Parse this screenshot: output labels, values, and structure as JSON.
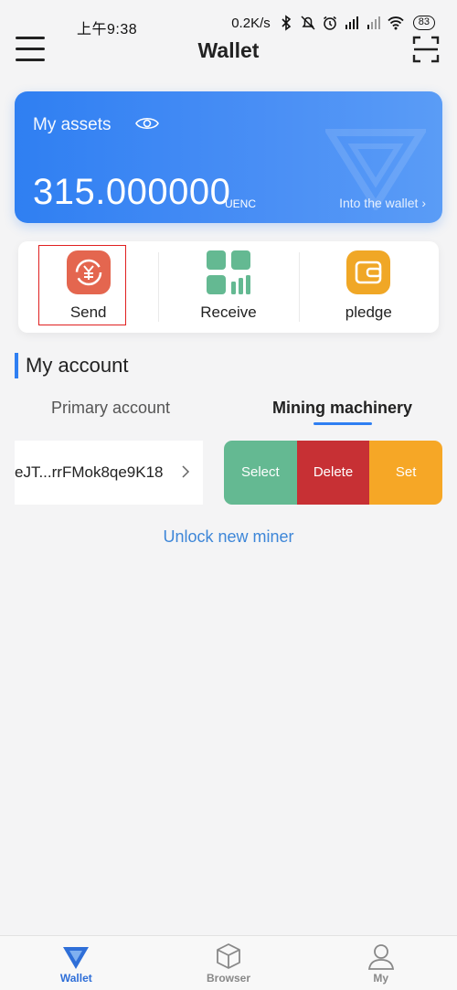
{
  "status_bar": {
    "time": "上午9:38",
    "speed": "0.2K/s",
    "battery": "83"
  },
  "header": {
    "title": "Wallet"
  },
  "assets": {
    "label": "My assets",
    "amount": "315.000000",
    "unit": "UENC",
    "into_wallet": "Into the wallet ›"
  },
  "actions": [
    {
      "label": "Send",
      "icon": "send-icon"
    },
    {
      "label": "Receive",
      "icon": "receive-icon"
    },
    {
      "label": "pledge",
      "icon": "pledge-icon"
    }
  ],
  "account": {
    "section_title": "My account",
    "tabs": [
      "Primary account",
      "Mining machinery"
    ],
    "active_tab": "Mining machinery",
    "address": "eJT...rrFMok8qe9K18",
    "swipe_actions": [
      "Select",
      "Delete",
      "Set"
    ],
    "unlock_link": "Unlock new miner"
  },
  "bottom_nav": [
    {
      "label": "Wallet",
      "icon": "wallet-icon",
      "active": true
    },
    {
      "label": "Browser",
      "icon": "cube-icon",
      "active": false
    },
    {
      "label": "My",
      "icon": "user-icon",
      "active": false
    }
  ],
  "colors": {
    "accent": "#2f7ff2",
    "send": "#e4664f",
    "receive": "#64b992",
    "pledge": "#f0a726",
    "delete": "#c73034"
  }
}
